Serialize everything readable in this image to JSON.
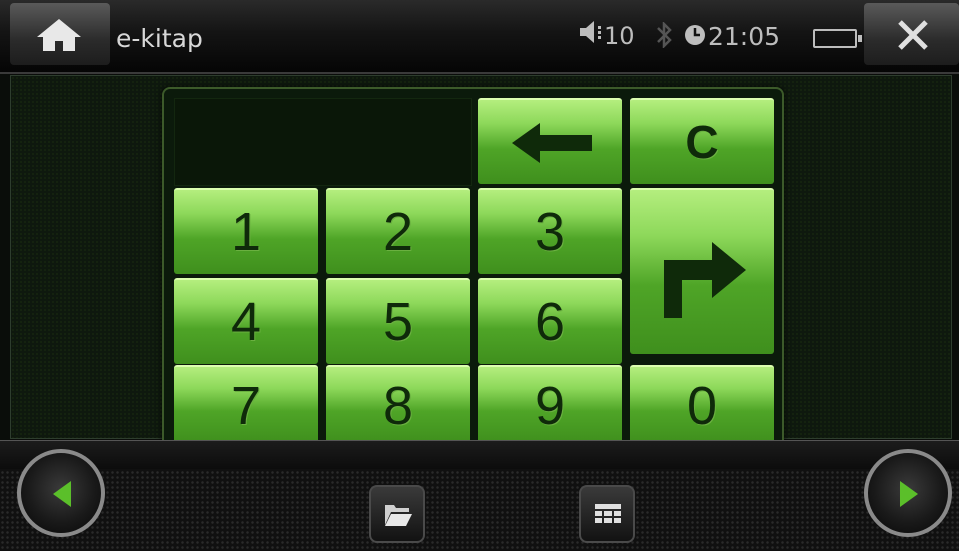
{
  "topbar": {
    "title": "e-kitap",
    "volume": "10",
    "time": "21:05",
    "icons": [
      "home-icon",
      "volume-icon",
      "bluetooth-icon",
      "clock-icon",
      "battery-icon",
      "close-icon"
    ]
  },
  "keypad": {
    "display_value": "",
    "keys": {
      "backspace": "backspace-arrow-icon",
      "clear": "C",
      "k1": "1",
      "k2": "2",
      "k3": "3",
      "k4": "4",
      "k5": "5",
      "k6": "6",
      "k7": "7",
      "k8": "8",
      "k9": "9",
      "k0": "0",
      "enter": "enter-arrow-icon"
    },
    "colors": {
      "key_green": "#8dd85a",
      "key_dark_green": "#3f8f1d",
      "digit": "#0f2a0a"
    }
  },
  "bottombar": {
    "icons": [
      "prev-icon",
      "folder-icon",
      "grid-icon",
      "next-icon"
    ]
  }
}
